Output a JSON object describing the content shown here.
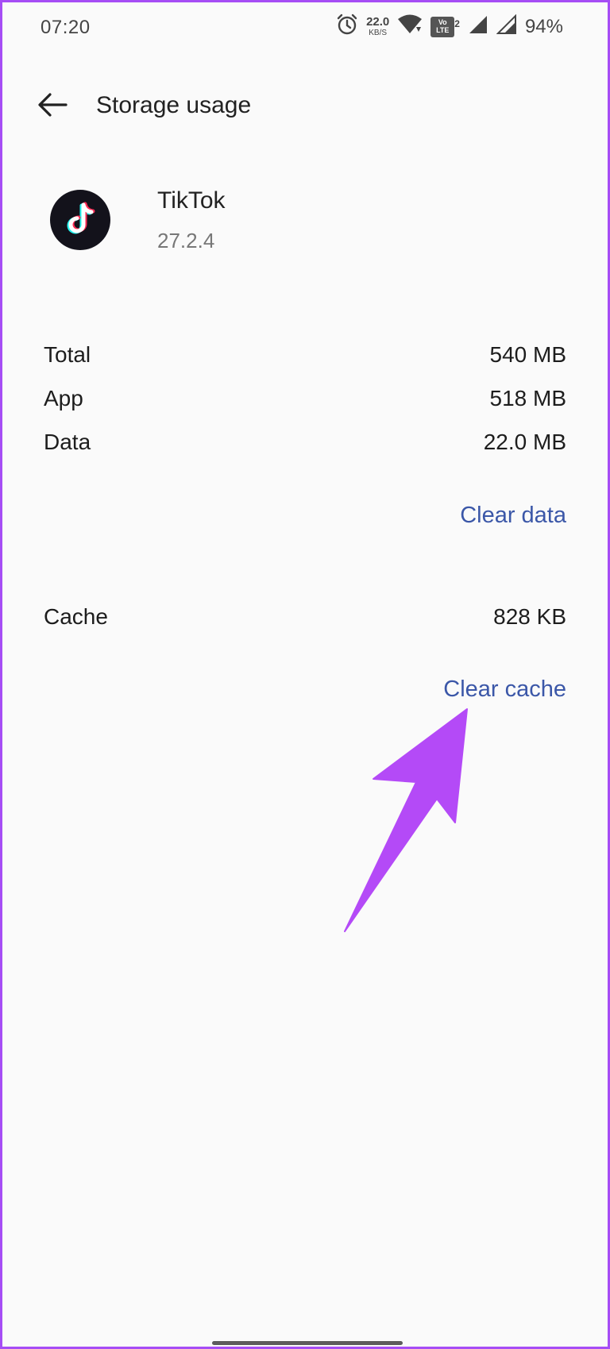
{
  "status_bar": {
    "time": "07:20",
    "net_speed": "22.0",
    "net_speed_unit": "KB/S",
    "volte_top": "Vo",
    "volte_bottom": "LTE",
    "sim_index": "2",
    "battery": "94%"
  },
  "header": {
    "title": "Storage usage"
  },
  "app": {
    "name": "TikTok",
    "version": "27.2.4"
  },
  "storage": {
    "rows": [
      {
        "label": "Total",
        "value": "540 MB"
      },
      {
        "label": "App",
        "value": "518 MB"
      },
      {
        "label": "Data",
        "value": "22.0 MB"
      }
    ],
    "clear_data_label": "Clear data",
    "cache": {
      "label": "Cache",
      "value": "828 KB"
    },
    "clear_cache_label": "Clear cache"
  },
  "colors": {
    "accent_link": "#3b57a8",
    "annotation_arrow": "#b44af7",
    "frame_border": "#a64df5"
  }
}
